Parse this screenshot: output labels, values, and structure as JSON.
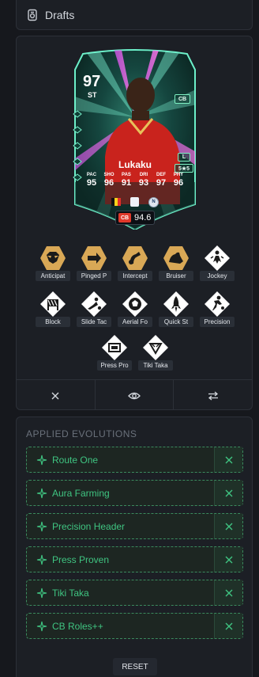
{
  "header": {
    "title": "Drafts"
  },
  "card": {
    "rating": "97",
    "position": "ST",
    "alt_position": "CB",
    "preferred_foot": "L",
    "skill_weak": "5★5",
    "name": "Lukaku",
    "stats": [
      {
        "label": "PAC",
        "value": "95"
      },
      {
        "label": "SHO",
        "value": "96"
      },
      {
        "label": "PAS",
        "value": "91"
      },
      {
        "label": "DRI",
        "value": "93"
      },
      {
        "label": "DEF",
        "value": "97"
      },
      {
        "label": "PHY",
        "value": "96"
      }
    ],
    "club_abbr": "N",
    "ovr_tag": "CB",
    "ovr_value": "94.6"
  },
  "playstyles": [
    {
      "label": "Anticipat",
      "icon": "raccoon-icon",
      "plus": true
    },
    {
      "label": "Pinged P",
      "icon": "arrow-icon",
      "plus": true
    },
    {
      "label": "Intercept",
      "icon": "hook-icon",
      "plus": true
    },
    {
      "label": "Bruiser",
      "icon": "flex-arm-icon",
      "plus": true
    },
    {
      "label": "Jockey",
      "icon": "jockey-icon",
      "plus": false
    },
    {
      "label": "Block",
      "icon": "block-icon",
      "plus": false
    },
    {
      "label": "Slide Tac",
      "icon": "slide-tackle-icon",
      "plus": false
    },
    {
      "label": "Aerial Fo",
      "icon": "aerial-ball-icon",
      "plus": false
    },
    {
      "label": "Quick St",
      "icon": "rocket-icon",
      "plus": false
    },
    {
      "label": "Precision",
      "icon": "kick-icon",
      "plus": false
    },
    {
      "label": "Press Pro",
      "icon": "press-icon",
      "plus": false
    },
    {
      "label": "Tiki Taka",
      "icon": "triangle-icon",
      "plus": false
    }
  ],
  "evolutions": {
    "heading": "APPLIED EVOLUTIONS",
    "items": [
      {
        "name": "Route One"
      },
      {
        "name": "Aura Farming"
      },
      {
        "name": "Precision Header"
      },
      {
        "name": "Press Proven"
      },
      {
        "name": "Tiki Taka"
      },
      {
        "name": "CB Roles++"
      }
    ],
    "reset_label": "RESET"
  },
  "colors": {
    "gold": "#d9a856",
    "accent_green": "#3fc481",
    "ovr_red": "#e0392b"
  }
}
